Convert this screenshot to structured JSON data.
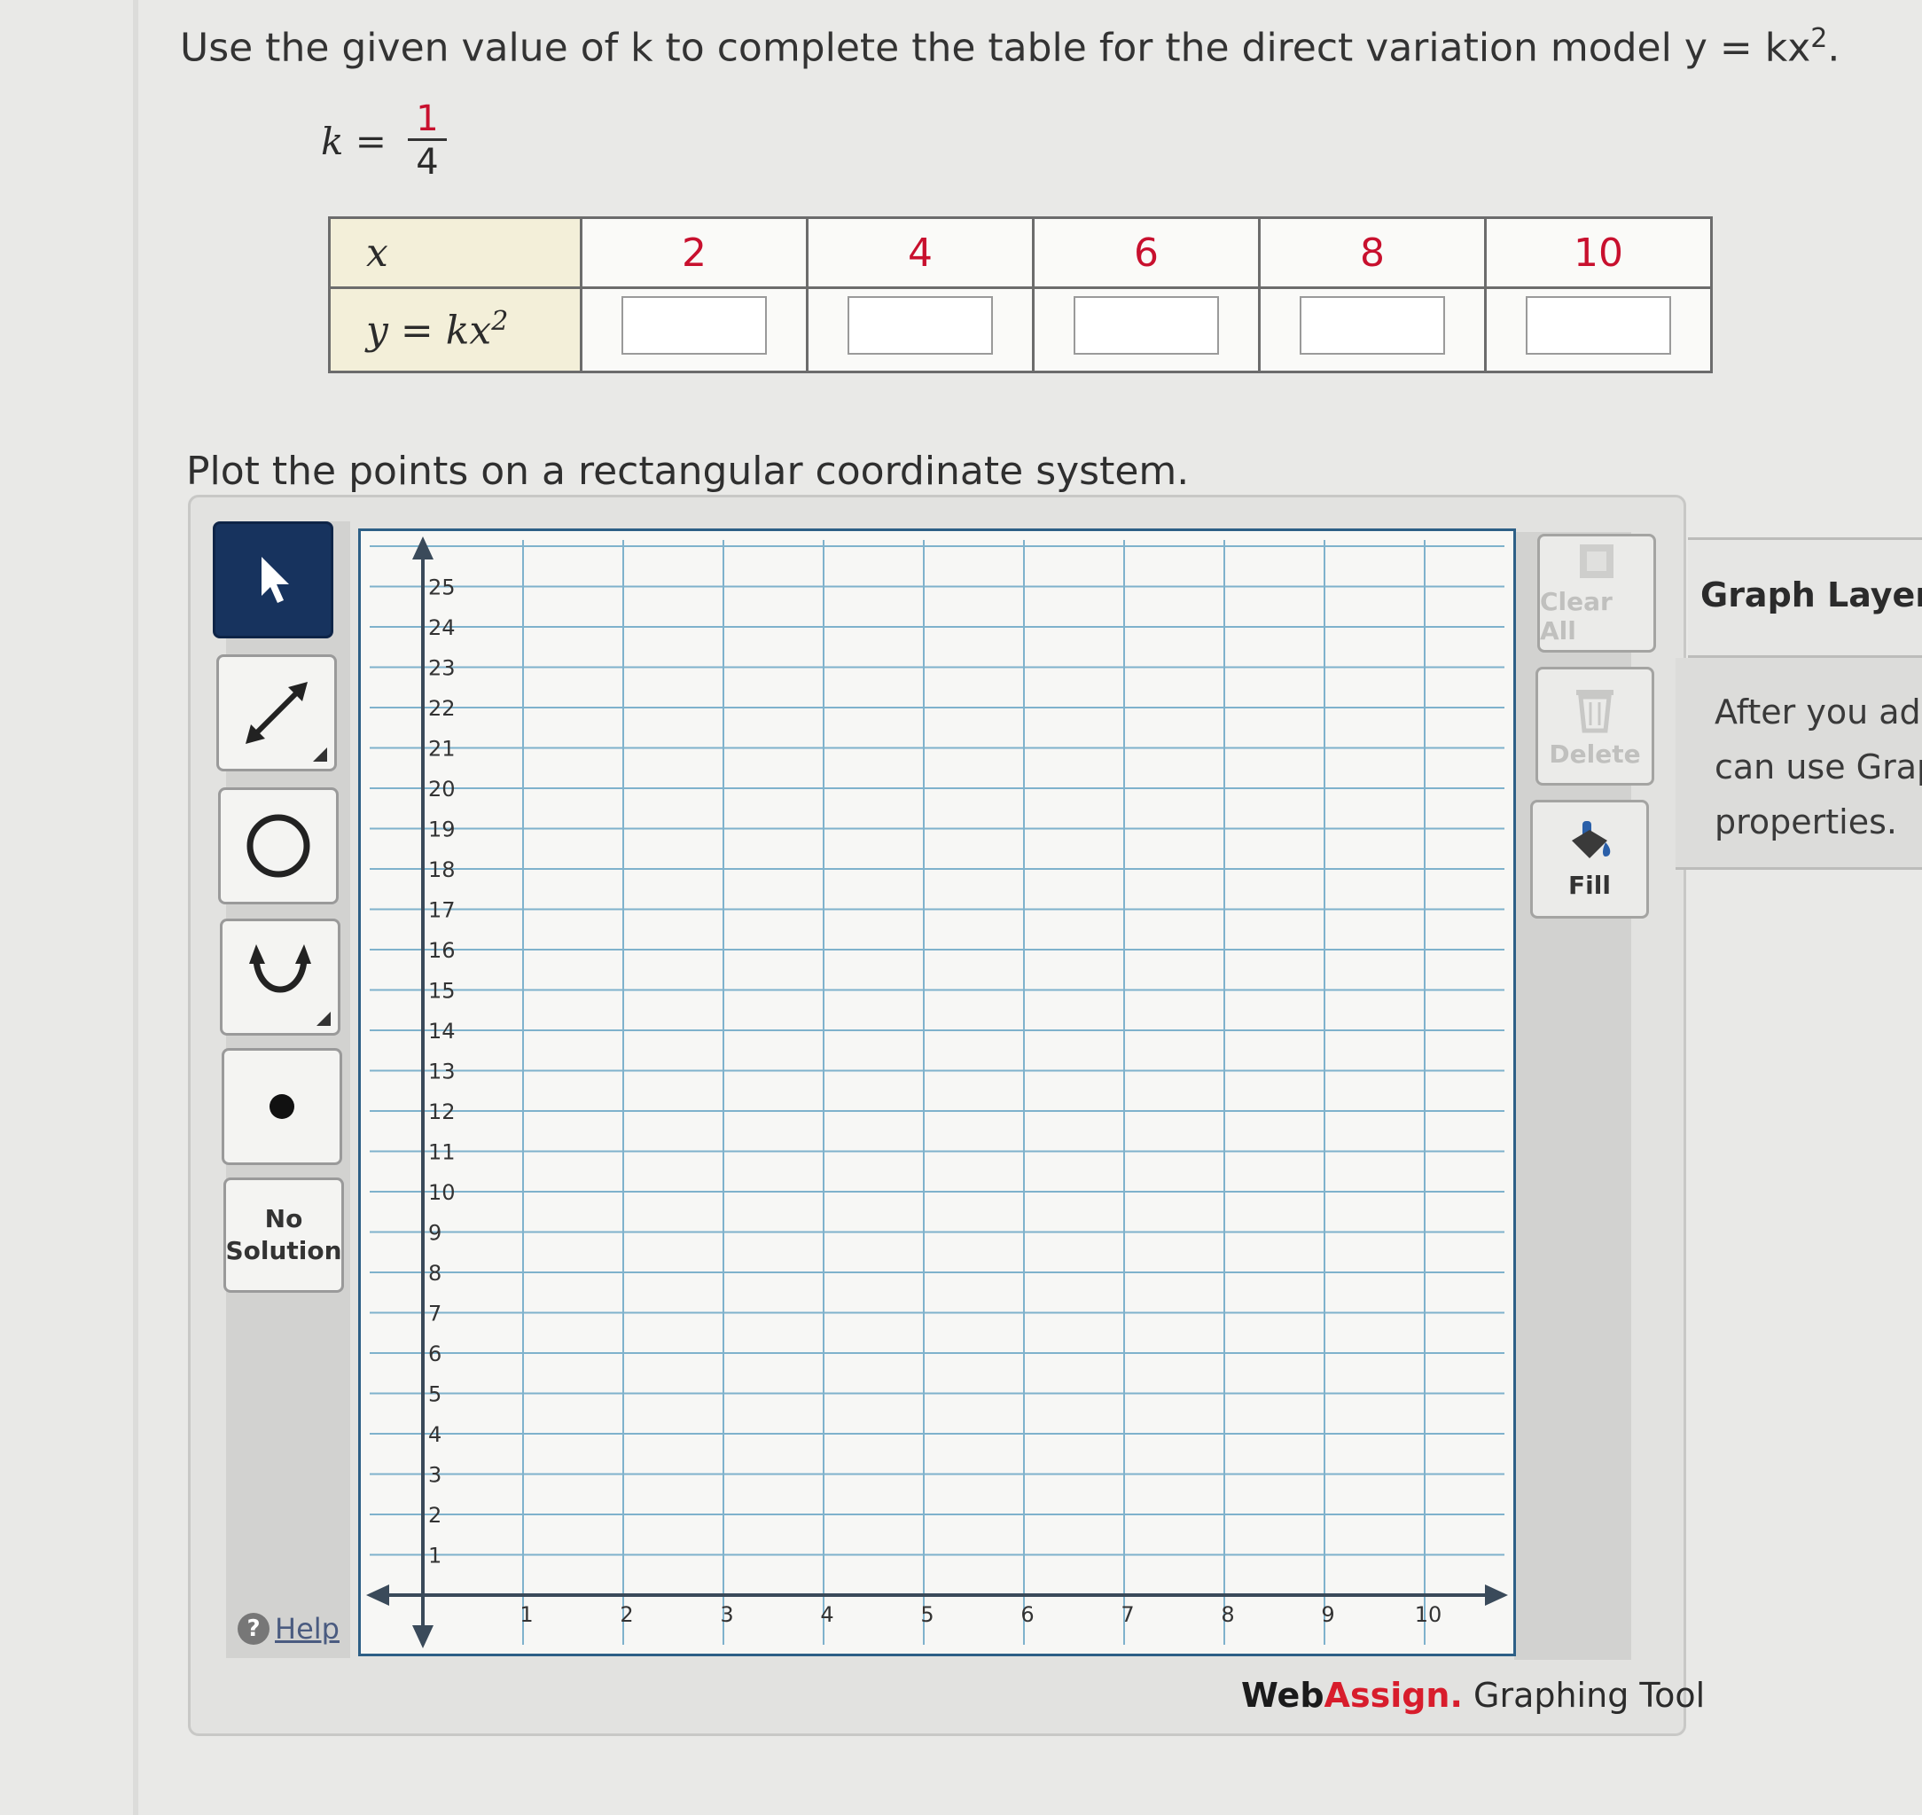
{
  "prompt": {
    "text": "Use the given value of k to complete the table for the direct variation model y = kx",
    "exponent": "2",
    "end": "."
  },
  "k_value": {
    "label": "k =",
    "numerator": "1",
    "denominator": "4"
  },
  "table": {
    "row1_header": "x",
    "row2_header": "y = kx",
    "row2_exponent": "2",
    "x_values": [
      "2",
      "4",
      "6",
      "8",
      "10"
    ],
    "y_inputs": [
      "",
      "",
      "",
      "",
      ""
    ]
  },
  "plot_instruction": "Plot the points on a rectangular coordinate system.",
  "toolbar": {
    "select_tool": "pointer",
    "line_tool": "line",
    "circle_tool": "circle",
    "parabola_tool": "parabola",
    "point_tool": "point",
    "no_solution_label_1": "No",
    "no_solution_label_2": "Solution",
    "help_label": "Help"
  },
  "graph": {
    "x_min": 0,
    "x_max": 10,
    "y_min": 0,
    "y_max": 25,
    "x_tick_labels": [
      "1",
      "2",
      "3",
      "4",
      "5",
      "6",
      "7",
      "8",
      "9",
      "10"
    ],
    "y_tick_labels": [
      "1",
      "2",
      "3",
      "4",
      "5",
      "6",
      "7",
      "8",
      "9",
      "10",
      "11",
      "12",
      "13",
      "14",
      "15",
      "16",
      "17",
      "18",
      "19",
      "20",
      "21",
      "22",
      "23",
      "24",
      "25"
    ],
    "grid": true,
    "grid_color": "#7fb2cc",
    "axis_color": "#3a4a5a"
  },
  "side_buttons": {
    "clear_all": "Clear All",
    "delete": "Delete",
    "fill": "Fill"
  },
  "layers": {
    "title": "Graph Layers",
    "lines": [
      "After you add",
      "can use Grap",
      "properties."
    ]
  },
  "brand": {
    "web": "Web",
    "assign": "Assign.",
    "tool": " Graphing Tool"
  }
}
